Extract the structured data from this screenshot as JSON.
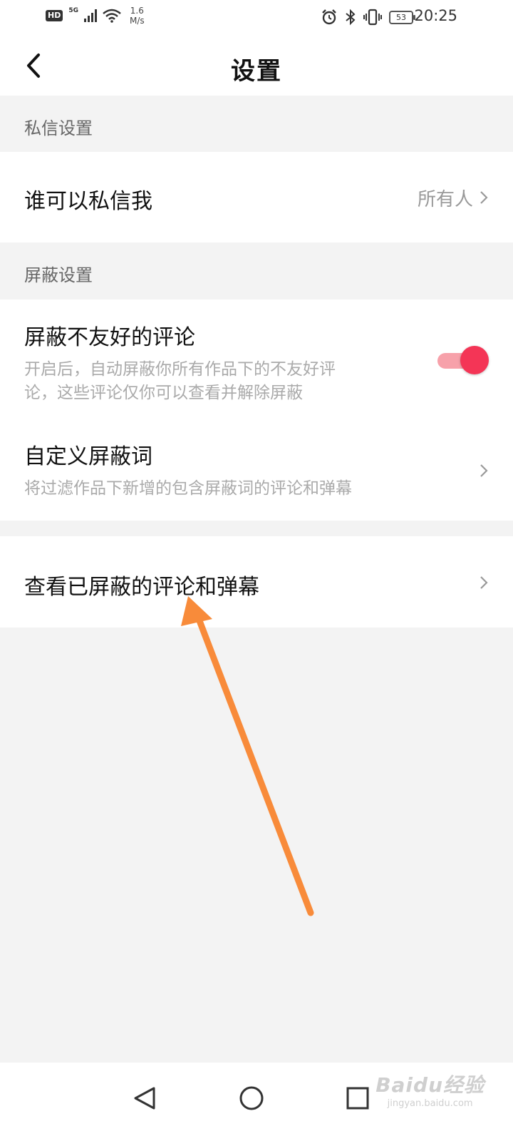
{
  "status_bar": {
    "hd": "HD",
    "network": "5G",
    "speed_value": "1.6",
    "speed_unit": "M/s",
    "battery": "53",
    "time": "20:25"
  },
  "header": {
    "title": "设置"
  },
  "sections": {
    "messages": {
      "label": "私信设置",
      "who_can_message": {
        "title": "谁可以私信我",
        "value": "所有人"
      }
    },
    "block": {
      "label": "屏蔽设置",
      "unfriendly": {
        "title": "屏蔽不友好的评论",
        "desc_line1": "开启后，自动屏蔽你所有作品下的不友好评",
        "desc_line2": "论，这些评论仅你可以查看并解除屏蔽",
        "enabled": true
      },
      "custom_words": {
        "title": "自定义屏蔽词",
        "desc": "将过滤作品下新增的包含屏蔽词的评论和弹幕"
      }
    },
    "view_blocked": {
      "title": "查看已屏蔽的评论和弹幕"
    }
  },
  "watermark": {
    "logo": "Baidu经验",
    "url": "jingyan.baidu.com"
  },
  "colors": {
    "accent": "#f43556",
    "toggle_track": "#f7a1aa",
    "arrow": "#f88b3a",
    "background": "#f3f3f3"
  },
  "icons": [
    "back-arrow-icon",
    "chevron-right-icon",
    "nav-back-icon",
    "nav-home-icon",
    "nav-recents-icon",
    "alarm-icon",
    "bluetooth-icon",
    "vibrate-icon",
    "wifi-icon",
    "signal-icon"
  ]
}
